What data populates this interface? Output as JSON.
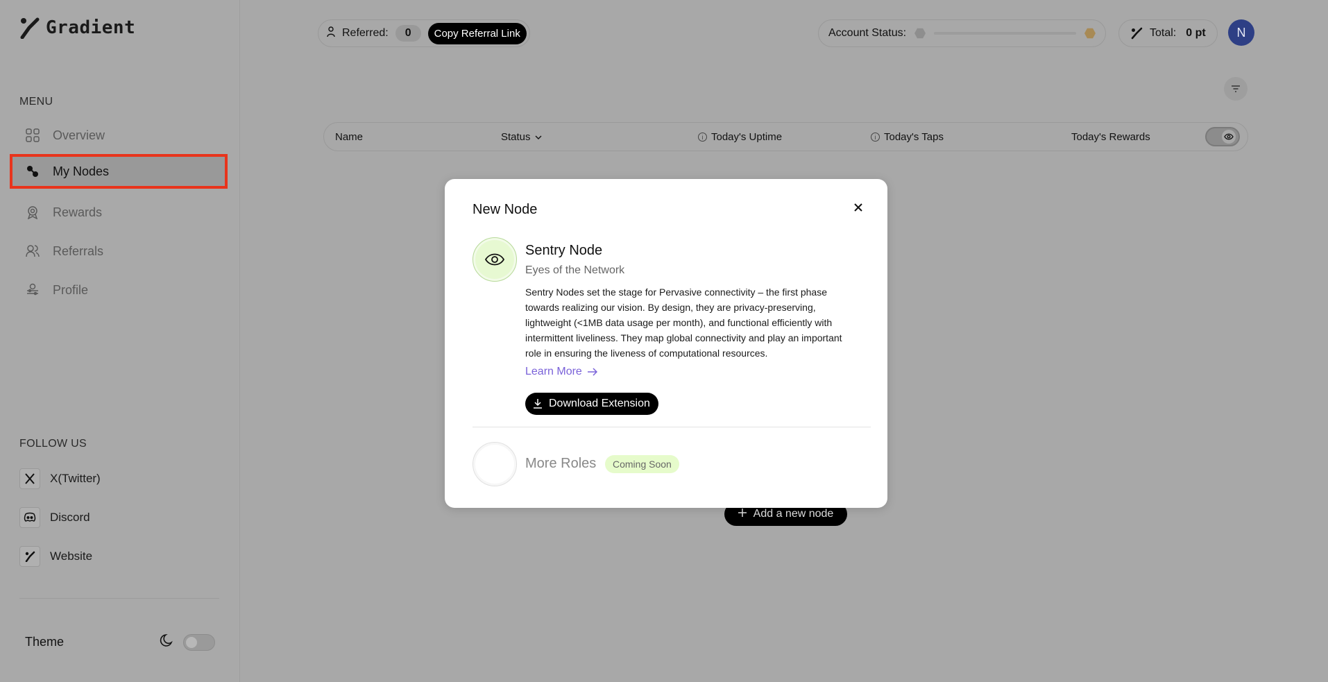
{
  "app": {
    "logo_text": "Gradient"
  },
  "sidebar": {
    "menu_label": "MENU",
    "items": [
      {
        "label": "Overview",
        "icon": "grid-icon"
      },
      {
        "label": "My Nodes",
        "icon": "nodes-icon",
        "active": true
      },
      {
        "label": "Rewards",
        "icon": "award-icon"
      },
      {
        "label": "Referrals",
        "icon": "users-icon"
      },
      {
        "label": "Profile",
        "icon": "profile-icon"
      }
    ],
    "follow_label": "FOLLOW US",
    "follow": [
      {
        "label": "X(Twitter)",
        "icon": "x-twitter-icon"
      },
      {
        "label": "Discord",
        "icon": "discord-icon"
      },
      {
        "label": "Website",
        "icon": "gradient-logo-icon"
      }
    ],
    "theme_label": "Theme"
  },
  "topbar": {
    "referred_label": "Referred:",
    "referred_count": "0",
    "copy_referral": "Copy Referral Link",
    "account_status_label": "Account Status:",
    "total_label": "Total:",
    "total_value": "0 pt",
    "avatar_initial": "N"
  },
  "table": {
    "columns": [
      "Name",
      "Status",
      "Today's Uptime",
      "Today's Taps",
      "Today's Rewards"
    ]
  },
  "add_node_label": "Add a new node",
  "modal": {
    "title": "New Node",
    "role": {
      "name": "Sentry Node",
      "subtitle": "Eyes of the Network",
      "description": "Sentry Nodes set the stage for Pervasive connectivity – the first phase towards realizing our vision. By design, they are privacy-preserving, lightweight (<1MB data usage per month), and functional efficiently with intermittent liveliness. They map global connectivity and play an important role in ensuring the liveness of computational resources.",
      "learn_more": "Learn More",
      "download": "Download Extension"
    },
    "more": {
      "name": "More Roles",
      "badge": "Coming Soon"
    }
  },
  "colors": {
    "accent_purple": "#7a62d9",
    "highlight_red": "#e8341c",
    "coming_soon_bg": "#e6fbcb",
    "avatar_bg": "#2e3f85"
  }
}
